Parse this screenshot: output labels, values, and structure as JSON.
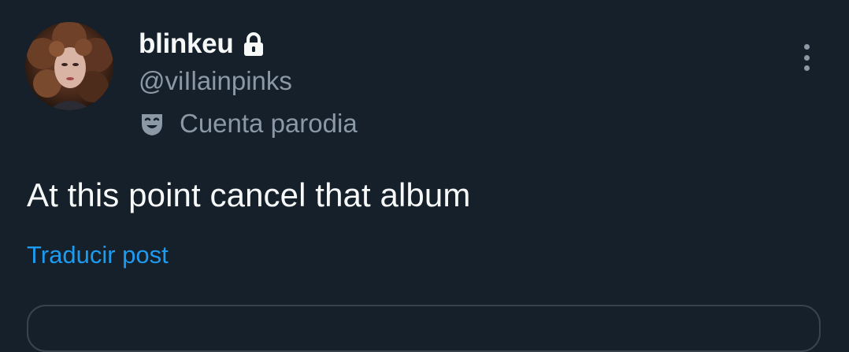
{
  "post": {
    "author": {
      "display_name": "blinkeu",
      "handle": "@viIlainpinks",
      "protected_icon": "lock-icon",
      "label_icon": "theater-mask-icon",
      "label": "Cuenta parodia"
    },
    "text": "At this point cancel that album",
    "translate_label": "Traducir post",
    "more_icon": "more-vertical-icon"
  },
  "colors": {
    "background": "#15202b",
    "primary_text": "#f7f9f9",
    "secondary_text": "#8b98a5",
    "link": "#1d9bf0",
    "border": "#38444d"
  }
}
